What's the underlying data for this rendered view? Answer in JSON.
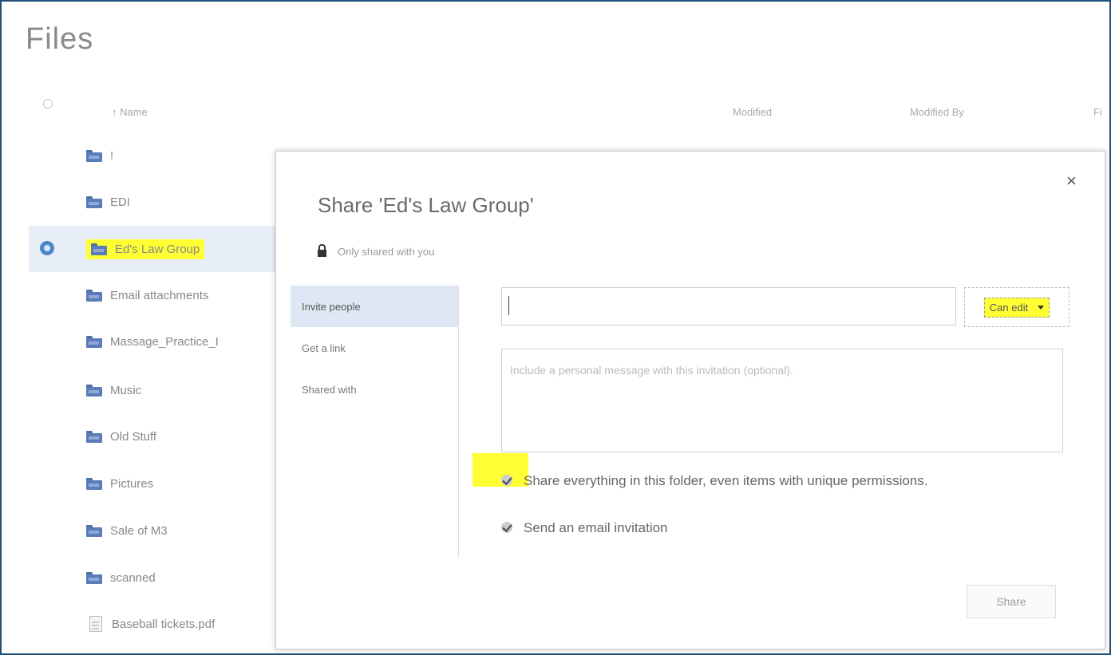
{
  "page": {
    "title": "Files"
  },
  "columns": {
    "name": "↑ Name",
    "modified": "Modified",
    "modified_by": "Modified By",
    "extra": "Fi"
  },
  "files": [
    {
      "name": "!",
      "type": "folder"
    },
    {
      "name": "EDI",
      "type": "folder"
    },
    {
      "name": "Ed's Law Group",
      "type": "folder"
    },
    {
      "name": "Email attachments",
      "type": "folder"
    },
    {
      "name": "Massage_Practice_I",
      "type": "folder"
    },
    {
      "name": "Music",
      "type": "folder"
    },
    {
      "name": "Old Stuff",
      "type": "folder"
    },
    {
      "name": "Pictures",
      "type": "folder"
    },
    {
      "name": "Sale of M3",
      "type": "folder"
    },
    {
      "name": "scanned",
      "type": "folder"
    },
    {
      "name": "Baseball tickets.pdf",
      "type": "pdf"
    }
  ],
  "dialog": {
    "title": "Share 'Ed's Law Group'",
    "close": "×",
    "sharing_status": "Only shared with you",
    "nav": [
      {
        "label": "Invite people"
      },
      {
        "label": "Get a link"
      },
      {
        "label": "Shared with"
      }
    ],
    "invite_input": {
      "value": "",
      "placeholder": ""
    },
    "permission": {
      "selected": "Can edit"
    },
    "message": {
      "placeholder": "Include a personal message with this invitation (optional)."
    },
    "options": {
      "share_everything": "Share everything in this folder, even items with unique permissions.",
      "send_email": "Send an email invitation"
    },
    "share_button": "Share"
  }
}
